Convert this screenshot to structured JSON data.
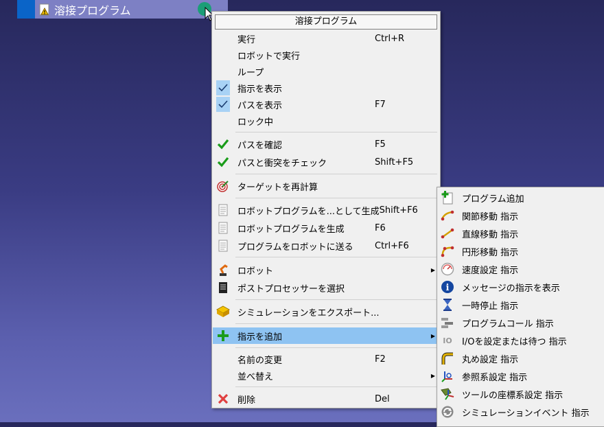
{
  "tree": {
    "item_label": "溶接プログラム"
  },
  "menu": {
    "title": "溶接プログラム",
    "items": [
      {
        "label": "実行",
        "shortcut": "Ctrl+R"
      },
      {
        "label": "ロボットで実行",
        "shortcut": ""
      },
      {
        "label": "ループ",
        "shortcut": ""
      },
      {
        "label": "指示を表示",
        "shortcut": "",
        "checked": true
      },
      {
        "label": "パスを表示",
        "shortcut": "F7",
        "checked": true
      },
      {
        "label": "ロック中",
        "shortcut": ""
      },
      {
        "label": "パスを確認",
        "shortcut": "F5"
      },
      {
        "label": "パスと衝突をチェック",
        "shortcut": "Shift+F5"
      },
      {
        "label": "ターゲットを再計算",
        "shortcut": ""
      },
      {
        "label": "ロボットプログラムを...として生成",
        "shortcut": "Shift+F6"
      },
      {
        "label": "ロボットプログラムを生成",
        "shortcut": "F6"
      },
      {
        "label": "プログラムをロボットに送る",
        "shortcut": "Ctrl+F6"
      },
      {
        "label": "ロボット",
        "shortcut": "",
        "submenu": true
      },
      {
        "label": "ポストプロセッサーを選択",
        "shortcut": ""
      },
      {
        "label": "シミュレーションをエクスポート...",
        "shortcut": ""
      },
      {
        "label": "指示を追加",
        "shortcut": "",
        "submenu": true,
        "highlighted": true
      },
      {
        "label": "名前の変更",
        "shortcut": "F2"
      },
      {
        "label": "並べ替え",
        "shortcut": "",
        "submenu": true
      },
      {
        "label": "削除",
        "shortcut": "Del"
      }
    ],
    "arrow_glyph": "▶"
  },
  "submenu": {
    "items": [
      {
        "label": "プログラム追加"
      },
      {
        "label": "関節移動 指示"
      },
      {
        "label": "直線移動 指示"
      },
      {
        "label": "円形移動 指示"
      },
      {
        "label": "速度設定 指示"
      },
      {
        "label": "メッセージの指示を表示"
      },
      {
        "label": "一時停止 指示"
      },
      {
        "label": "プログラムコール 指示"
      },
      {
        "label": "I/Oを設定または待つ 指示"
      },
      {
        "label": "丸め設定 指示"
      },
      {
        "label": "参照系設定 指示"
      },
      {
        "label": "ツールの座標系設定 指示"
      },
      {
        "label": "シミュレーションイベント 指示"
      }
    ],
    "io_glyph": "IO",
    "info_glyph": "i"
  },
  "colors": {
    "highlight": "#8ec3f2",
    "check_bg": "#a8d2f5",
    "green": "#1a9c1a",
    "red": "#e04040"
  }
}
